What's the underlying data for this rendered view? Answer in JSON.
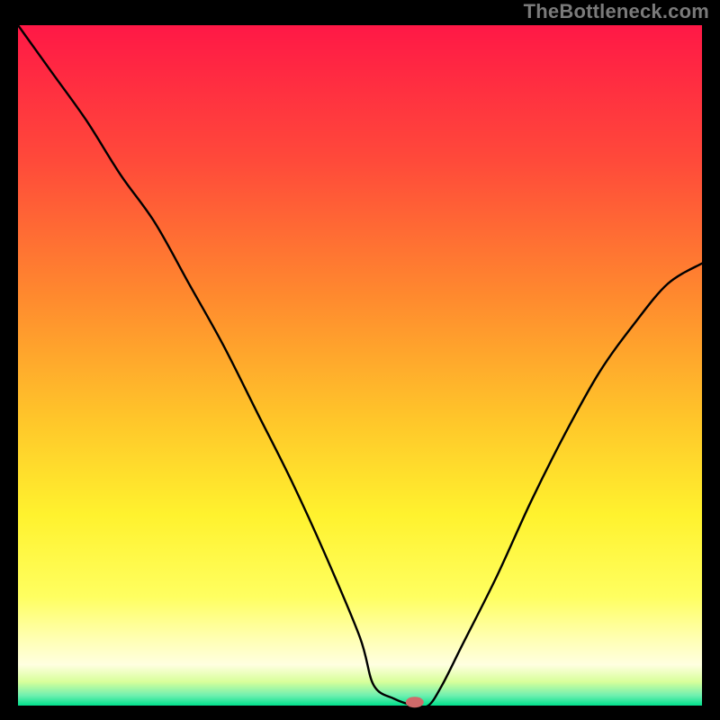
{
  "watermark": "TheBottleneck.com",
  "chart_data": {
    "type": "line",
    "title": "",
    "xlabel": "",
    "ylabel": "",
    "xlim": [
      0,
      100
    ],
    "ylim": [
      0,
      100
    ],
    "grid": false,
    "legend": false,
    "curve": {
      "name": "bottleneck-curve",
      "color": "#000000",
      "x": [
        0,
        5,
        10,
        15,
        20,
        25,
        30,
        35,
        40,
        45,
        50,
        52,
        55,
        58,
        60,
        62,
        65,
        70,
        75,
        80,
        85,
        90,
        95,
        100
      ],
      "y": [
        100,
        93,
        86,
        78,
        71,
        62,
        53,
        43,
        33,
        22,
        10,
        3,
        1,
        0,
        0,
        3,
        9,
        19,
        30,
        40,
        49,
        56,
        62,
        65
      ]
    },
    "marker": {
      "name": "optimal-marker",
      "x": 58,
      "y": 0.5,
      "color": "#d06a6a",
      "rx": 10,
      "ry": 6
    },
    "background": {
      "type": "vertical-gradient",
      "stops": [
        {
          "pos": 0.0,
          "color": "#ff1846"
        },
        {
          "pos": 0.2,
          "color": "#ff4a3a"
        },
        {
          "pos": 0.4,
          "color": "#ff8a2e"
        },
        {
          "pos": 0.58,
          "color": "#ffc62a"
        },
        {
          "pos": 0.72,
          "color": "#fff22e"
        },
        {
          "pos": 0.84,
          "color": "#ffff60"
        },
        {
          "pos": 0.9,
          "color": "#ffffb0"
        },
        {
          "pos": 0.94,
          "color": "#ffffe0"
        },
        {
          "pos": 0.965,
          "color": "#d8ff9a"
        },
        {
          "pos": 0.985,
          "color": "#70f0b0"
        },
        {
          "pos": 1.0,
          "color": "#00e08c"
        }
      ]
    },
    "axes": {
      "color": "#000000",
      "left_width": 20,
      "right_width": 20,
      "bottom_height": 16,
      "top_height": 28
    }
  }
}
